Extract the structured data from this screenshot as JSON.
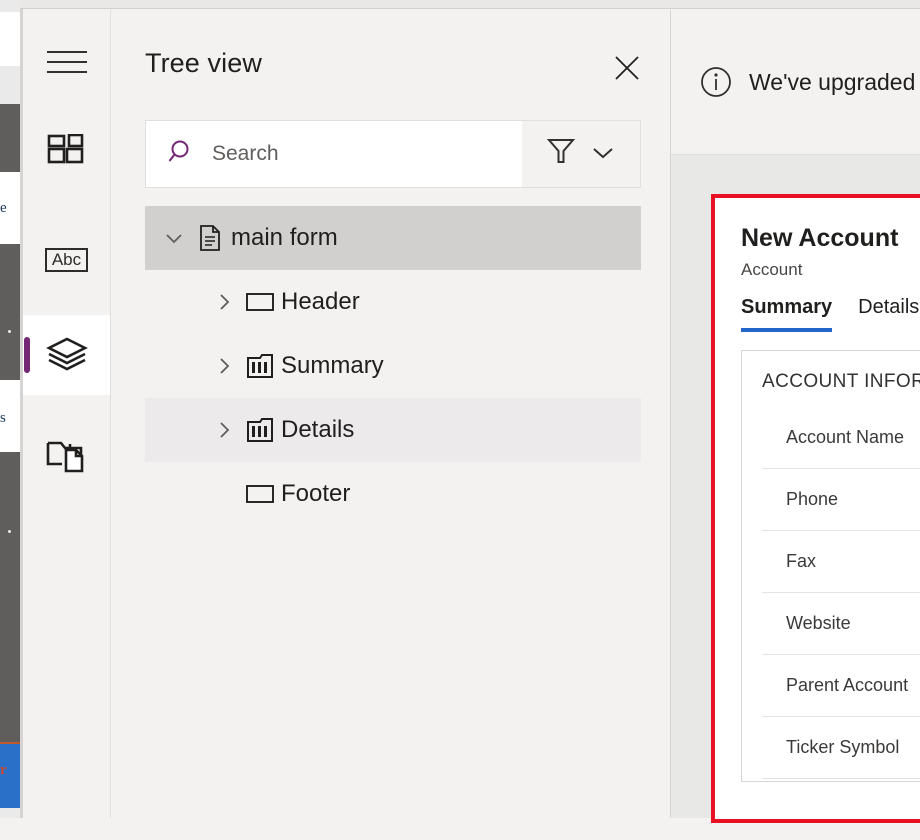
{
  "background_app": {
    "visible_text_fragments": [
      "e",
      "s"
    ],
    "blue_fragment": "r"
  },
  "app_rail": {
    "items": [
      {
        "name": "menu",
        "icon": "hamburger-icon",
        "selected": false
      },
      {
        "name": "components",
        "icon": "grid-blocks-icon",
        "selected": false
      },
      {
        "name": "text",
        "icon": "abc-text-icon",
        "selected": false,
        "glyph": "Abc"
      },
      {
        "name": "tree-view",
        "icon": "layers-icon",
        "selected": true
      },
      {
        "name": "library",
        "icon": "folder-file-icon",
        "selected": false
      }
    ]
  },
  "tree_panel": {
    "title": "Tree view",
    "close_icon": "close-icon",
    "search": {
      "placeholder": "Search",
      "value": "",
      "search_icon": "search-icon",
      "filter_icon": "filter-icon",
      "chevron_icon": "chevron-down-icon"
    },
    "items": [
      {
        "label": "main form",
        "icon": "document-icon",
        "chevron": "chevron-down",
        "indent": 0,
        "state": "selected"
      },
      {
        "label": "Header",
        "icon": "rectangle-icon",
        "chevron": "chevron-right",
        "indent": 1,
        "state": "normal"
      },
      {
        "label": "Summary",
        "icon": "columns-icon",
        "chevron": "chevron-right",
        "indent": 1,
        "state": "normal"
      },
      {
        "label": "Details",
        "icon": "columns-icon",
        "chevron": "chevron-right",
        "indent": 1,
        "state": "hover"
      },
      {
        "label": "Footer",
        "icon": "rectangle-icon",
        "chevron": "none",
        "indent": 1,
        "state": "normal"
      }
    ]
  },
  "right_pane": {
    "notification": {
      "icon": "info-icon",
      "text": "We've upgraded"
    },
    "form_preview": {
      "highlight_color": "#e81123",
      "title": "New Account",
      "subtitle": "Account",
      "tabs": [
        {
          "label": "Summary",
          "active": true
        },
        {
          "label": "Details",
          "active": false
        }
      ],
      "section_title": "ACCOUNT INFOR",
      "fields": [
        {
          "label": "Account Name"
        },
        {
          "label": "Phone"
        },
        {
          "label": "Fax"
        },
        {
          "label": "Website"
        },
        {
          "label": "Parent Account"
        },
        {
          "label": "Ticker Symbol"
        }
      ]
    }
  },
  "colors": {
    "accent_purple": "#742774",
    "tab_underline_blue": "#2266cc",
    "highlight_red": "#e81123",
    "panel_bg": "#f3f2f1"
  }
}
